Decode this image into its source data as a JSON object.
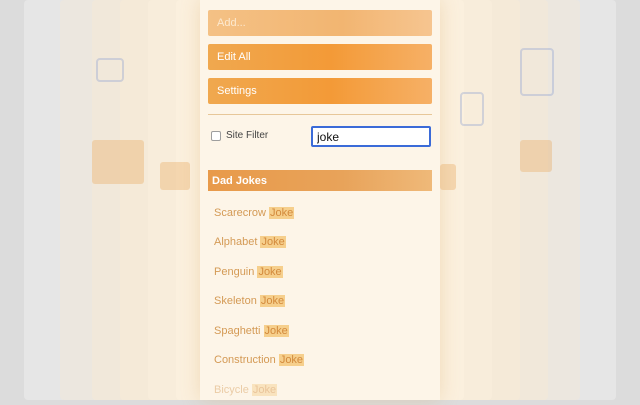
{
  "menu": {
    "add_label": "Add...",
    "edit_all_label": "Edit All",
    "settings_label": "Settings"
  },
  "filter": {
    "site_filter_label": "Site Filter",
    "site_filter_checked": false,
    "search_value": "joke"
  },
  "section": {
    "title": "Dad Jokes",
    "items": [
      {
        "prefix": "Scarecrow ",
        "match": "Joke"
      },
      {
        "prefix": "Alphabet ",
        "match": "Joke"
      },
      {
        "prefix": "Penguin ",
        "match": "Joke"
      },
      {
        "prefix": "Skeleton ",
        "match": "Joke"
      },
      {
        "prefix": "Spaghetti ",
        "match": "Joke"
      },
      {
        "prefix": "Construction ",
        "match": "Joke"
      },
      {
        "prefix": "Bicycle ",
        "match": "Joke"
      }
    ]
  },
  "colors": {
    "accent": "#f39a37",
    "highlight": "#f6cf8c",
    "input_border": "#3b6bd8"
  }
}
